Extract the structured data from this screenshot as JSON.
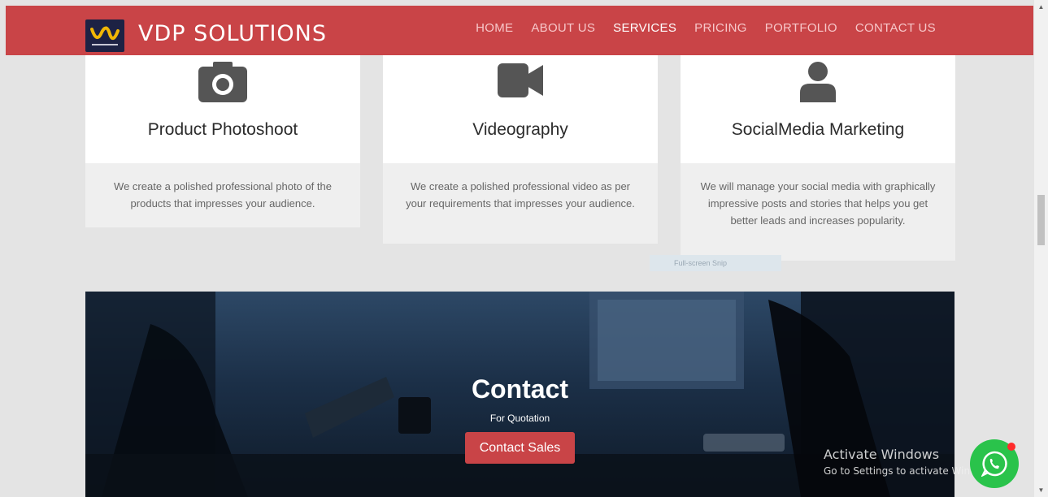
{
  "header": {
    "brand": "VDP SOLUTIONS",
    "logo_icon": "vdp-logo-icon",
    "nav": [
      {
        "label": "HOME",
        "active": false
      },
      {
        "label": "ABOUT US",
        "active": false
      },
      {
        "label": "SERVICES",
        "active": true
      },
      {
        "label": "PRICING",
        "active": false
      },
      {
        "label": "PORTFOLIO",
        "active": false
      },
      {
        "label": "CONTACT US",
        "active": false
      }
    ]
  },
  "services": [
    {
      "icon": "camera-icon",
      "title": "Product Photoshoot",
      "description": "We create a polished professional photo of the products that impresses your audience."
    },
    {
      "icon": "video-camera-icon",
      "title": "Videography",
      "description": "We create a polished professional video as per your requirements that impresses your audience."
    },
    {
      "icon": "user-icon",
      "title": "SocialMedia Marketing",
      "description": "We will manage your social media with graphically impressive posts and stories that helps you get better leads and increases popularity."
    }
  ],
  "snip_overlay": "Full-screen Snip",
  "contact": {
    "title": "Contact",
    "subtitle": "For Quotation",
    "button_label": "Contact Sales"
  },
  "windows_watermark": {
    "line1": "Activate Windows",
    "line2": "Go to Settings to activate Windows."
  },
  "whatsapp": {
    "icon": "whatsapp-icon"
  },
  "colors": {
    "brand_red": "#c94447",
    "whatsapp_green": "#2ac34b",
    "logo_bg": "#1d2244",
    "logo_gold": "#f2b705"
  }
}
